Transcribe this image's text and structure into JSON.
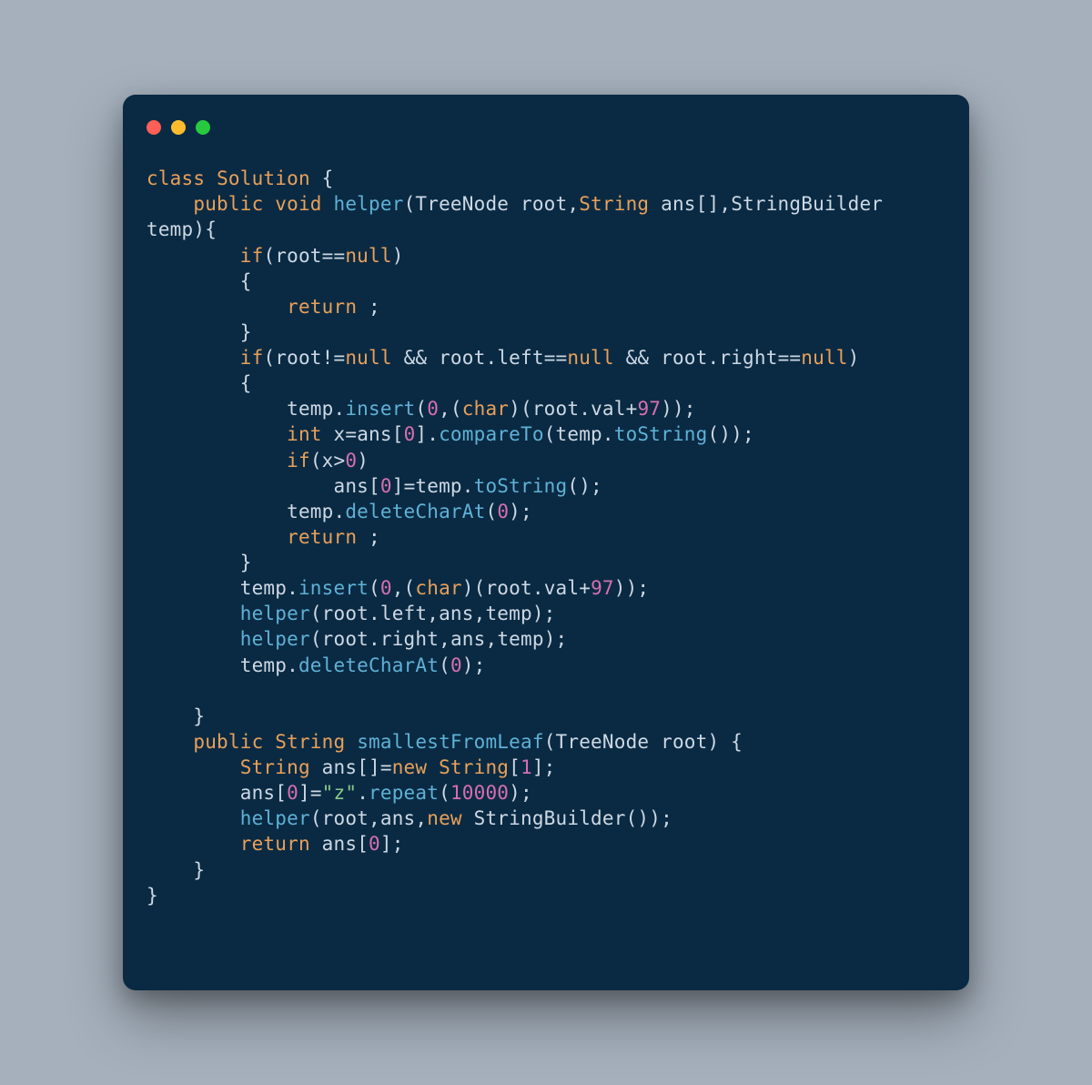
{
  "window": {
    "traffic_lights": [
      "red",
      "yellow",
      "green"
    ]
  },
  "code": {
    "tokens": [
      [
        [
          "k",
          "class"
        ],
        [
          "p",
          " "
        ],
        [
          "t",
          "Solution"
        ],
        [
          "p",
          " {"
        ]
      ],
      [
        [
          "p",
          "    "
        ],
        [
          "k",
          "public"
        ],
        [
          "p",
          " "
        ],
        [
          "k",
          "void"
        ],
        [
          "p",
          " "
        ],
        [
          "fn",
          "helper"
        ],
        [
          "p",
          "("
        ],
        [
          "id",
          "TreeNode"
        ],
        [
          "p",
          " "
        ],
        [
          "id",
          "root"
        ],
        [
          "p",
          ","
        ],
        [
          "t",
          "String"
        ],
        [
          "p",
          " "
        ],
        [
          "id",
          "ans"
        ],
        [
          "p",
          "[],"
        ],
        [
          "id",
          "StringBuilder"
        ],
        [
          "p",
          " "
        ]
      ],
      [
        [
          "id",
          "temp"
        ],
        [
          "p",
          ")"
        ],
        [
          "p",
          "{"
        ]
      ],
      [
        [
          "p",
          "        "
        ],
        [
          "k",
          "if"
        ],
        [
          "p",
          "("
        ],
        [
          "id",
          "root"
        ],
        [
          "op",
          "=="
        ],
        [
          "kw-null",
          "null"
        ],
        [
          "p",
          ")"
        ]
      ],
      [
        [
          "p",
          "        {"
        ]
      ],
      [
        [
          "p",
          "            "
        ],
        [
          "k",
          "return"
        ],
        [
          "p",
          " ;"
        ]
      ],
      [
        [
          "p",
          "        }"
        ]
      ],
      [
        [
          "p",
          "        "
        ],
        [
          "k",
          "if"
        ],
        [
          "p",
          "("
        ],
        [
          "id",
          "root"
        ],
        [
          "op",
          "!="
        ],
        [
          "kw-null",
          "null"
        ],
        [
          "p",
          " "
        ],
        [
          "op",
          "&&"
        ],
        [
          "p",
          " "
        ],
        [
          "id",
          "root"
        ],
        [
          "p",
          "."
        ],
        [
          "id",
          "left"
        ],
        [
          "op",
          "=="
        ],
        [
          "kw-null",
          "null"
        ],
        [
          "p",
          " "
        ],
        [
          "op",
          "&&"
        ],
        [
          "p",
          " "
        ],
        [
          "id",
          "root"
        ],
        [
          "p",
          "."
        ],
        [
          "id",
          "right"
        ],
        [
          "op",
          "=="
        ],
        [
          "kw-null",
          "null"
        ],
        [
          "p",
          ")"
        ]
      ],
      [
        [
          "p",
          "        {"
        ]
      ],
      [
        [
          "p",
          "            "
        ],
        [
          "id",
          "temp"
        ],
        [
          "p",
          "."
        ],
        [
          "fn",
          "insert"
        ],
        [
          "p",
          "("
        ],
        [
          "n",
          "0"
        ],
        [
          "p",
          ",("
        ],
        [
          "k",
          "char"
        ],
        [
          "p",
          ")("
        ],
        [
          "id",
          "root"
        ],
        [
          "p",
          "."
        ],
        [
          "id",
          "val"
        ],
        [
          "op",
          "+"
        ],
        [
          "n",
          "97"
        ],
        [
          "p",
          "));"
        ]
      ],
      [
        [
          "p",
          "            "
        ],
        [
          "k",
          "int"
        ],
        [
          "p",
          " "
        ],
        [
          "id",
          "x"
        ],
        [
          "op",
          "="
        ],
        [
          "id",
          "ans"
        ],
        [
          "p",
          "["
        ],
        [
          "n",
          "0"
        ],
        [
          "p",
          "]."
        ],
        [
          "fn",
          "compareTo"
        ],
        [
          "p",
          "("
        ],
        [
          "id",
          "temp"
        ],
        [
          "p",
          "."
        ],
        [
          "fn",
          "toString"
        ],
        [
          "p",
          "());"
        ]
      ],
      [
        [
          "p",
          "            "
        ],
        [
          "k",
          "if"
        ],
        [
          "p",
          "("
        ],
        [
          "id",
          "x"
        ],
        [
          "op",
          ">"
        ],
        [
          "n",
          "0"
        ],
        [
          "p",
          ")"
        ]
      ],
      [
        [
          "p",
          "                "
        ],
        [
          "id",
          "ans"
        ],
        [
          "p",
          "["
        ],
        [
          "n",
          "0"
        ],
        [
          "p",
          "]"
        ],
        [
          "op",
          "="
        ],
        [
          "id",
          "temp"
        ],
        [
          "p",
          "."
        ],
        [
          "fn",
          "toString"
        ],
        [
          "p",
          "();"
        ]
      ],
      [
        [
          "p",
          "            "
        ],
        [
          "id",
          "temp"
        ],
        [
          "p",
          "."
        ],
        [
          "fn",
          "deleteCharAt"
        ],
        [
          "p",
          "("
        ],
        [
          "n",
          "0"
        ],
        [
          "p",
          ");"
        ]
      ],
      [
        [
          "p",
          "            "
        ],
        [
          "k",
          "return"
        ],
        [
          "p",
          " ;"
        ]
      ],
      [
        [
          "p",
          "        }"
        ]
      ],
      [
        [
          "p",
          "        "
        ],
        [
          "id",
          "temp"
        ],
        [
          "p",
          "."
        ],
        [
          "fn",
          "insert"
        ],
        [
          "p",
          "("
        ],
        [
          "n",
          "0"
        ],
        [
          "p",
          ",("
        ],
        [
          "k",
          "char"
        ],
        [
          "p",
          ")("
        ],
        [
          "id",
          "root"
        ],
        [
          "p",
          "."
        ],
        [
          "id",
          "val"
        ],
        [
          "op",
          "+"
        ],
        [
          "n",
          "97"
        ],
        [
          "p",
          "));"
        ]
      ],
      [
        [
          "p",
          "        "
        ],
        [
          "fn",
          "helper"
        ],
        [
          "p",
          "("
        ],
        [
          "id",
          "root"
        ],
        [
          "p",
          "."
        ],
        [
          "id",
          "left"
        ],
        [
          "p",
          ","
        ],
        [
          "id",
          "ans"
        ],
        [
          "p",
          ","
        ],
        [
          "id",
          "temp"
        ],
        [
          "p",
          ");"
        ]
      ],
      [
        [
          "p",
          "        "
        ],
        [
          "fn",
          "helper"
        ],
        [
          "p",
          "("
        ],
        [
          "id",
          "root"
        ],
        [
          "p",
          "."
        ],
        [
          "id",
          "right"
        ],
        [
          "p",
          ","
        ],
        [
          "id",
          "ans"
        ],
        [
          "p",
          ","
        ],
        [
          "id",
          "temp"
        ],
        [
          "p",
          ");"
        ]
      ],
      [
        [
          "p",
          "        "
        ],
        [
          "id",
          "temp"
        ],
        [
          "p",
          "."
        ],
        [
          "fn",
          "deleteCharAt"
        ],
        [
          "p",
          "("
        ],
        [
          "n",
          "0"
        ],
        [
          "p",
          ");"
        ]
      ],
      [
        [
          "p",
          "        "
        ]
      ],
      [
        [
          "p",
          "    }"
        ]
      ],
      [
        [
          "p",
          "    "
        ],
        [
          "k",
          "public"
        ],
        [
          "p",
          " "
        ],
        [
          "t",
          "String"
        ],
        [
          "p",
          " "
        ],
        [
          "fn",
          "smallestFromLeaf"
        ],
        [
          "p",
          "("
        ],
        [
          "id",
          "TreeNode"
        ],
        [
          "p",
          " "
        ],
        [
          "id",
          "root"
        ],
        [
          "p",
          ") {"
        ]
      ],
      [
        [
          "p",
          "        "
        ],
        [
          "t",
          "String"
        ],
        [
          "p",
          " "
        ],
        [
          "id",
          "ans"
        ],
        [
          "p",
          "[]"
        ],
        [
          "op",
          "="
        ],
        [
          "k",
          "new"
        ],
        [
          "p",
          " "
        ],
        [
          "t",
          "String"
        ],
        [
          "p",
          "["
        ],
        [
          "n",
          "1"
        ],
        [
          "p",
          "];"
        ]
      ],
      [
        [
          "p",
          "        "
        ],
        [
          "id",
          "ans"
        ],
        [
          "p",
          "["
        ],
        [
          "n",
          "0"
        ],
        [
          "p",
          "]"
        ],
        [
          "op",
          "="
        ],
        [
          "s",
          "\"z\""
        ],
        [
          "p",
          "."
        ],
        [
          "fn",
          "repeat"
        ],
        [
          "p",
          "("
        ],
        [
          "n",
          "10000"
        ],
        [
          "p",
          ");"
        ]
      ],
      [
        [
          "p",
          "        "
        ],
        [
          "fn",
          "helper"
        ],
        [
          "p",
          "("
        ],
        [
          "id",
          "root"
        ],
        [
          "p",
          ","
        ],
        [
          "id",
          "ans"
        ],
        [
          "p",
          ","
        ],
        [
          "k",
          "new"
        ],
        [
          "p",
          " "
        ],
        [
          "id",
          "StringBuilder"
        ],
        [
          "p",
          "());"
        ]
      ],
      [
        [
          "p",
          "        "
        ],
        [
          "k",
          "return"
        ],
        [
          "p",
          " "
        ],
        [
          "id",
          "ans"
        ],
        [
          "p",
          "["
        ],
        [
          "n",
          "0"
        ],
        [
          "p",
          "];"
        ]
      ],
      [
        [
          "p",
          "    }"
        ]
      ],
      [
        [
          "p",
          "}"
        ]
      ]
    ]
  }
}
